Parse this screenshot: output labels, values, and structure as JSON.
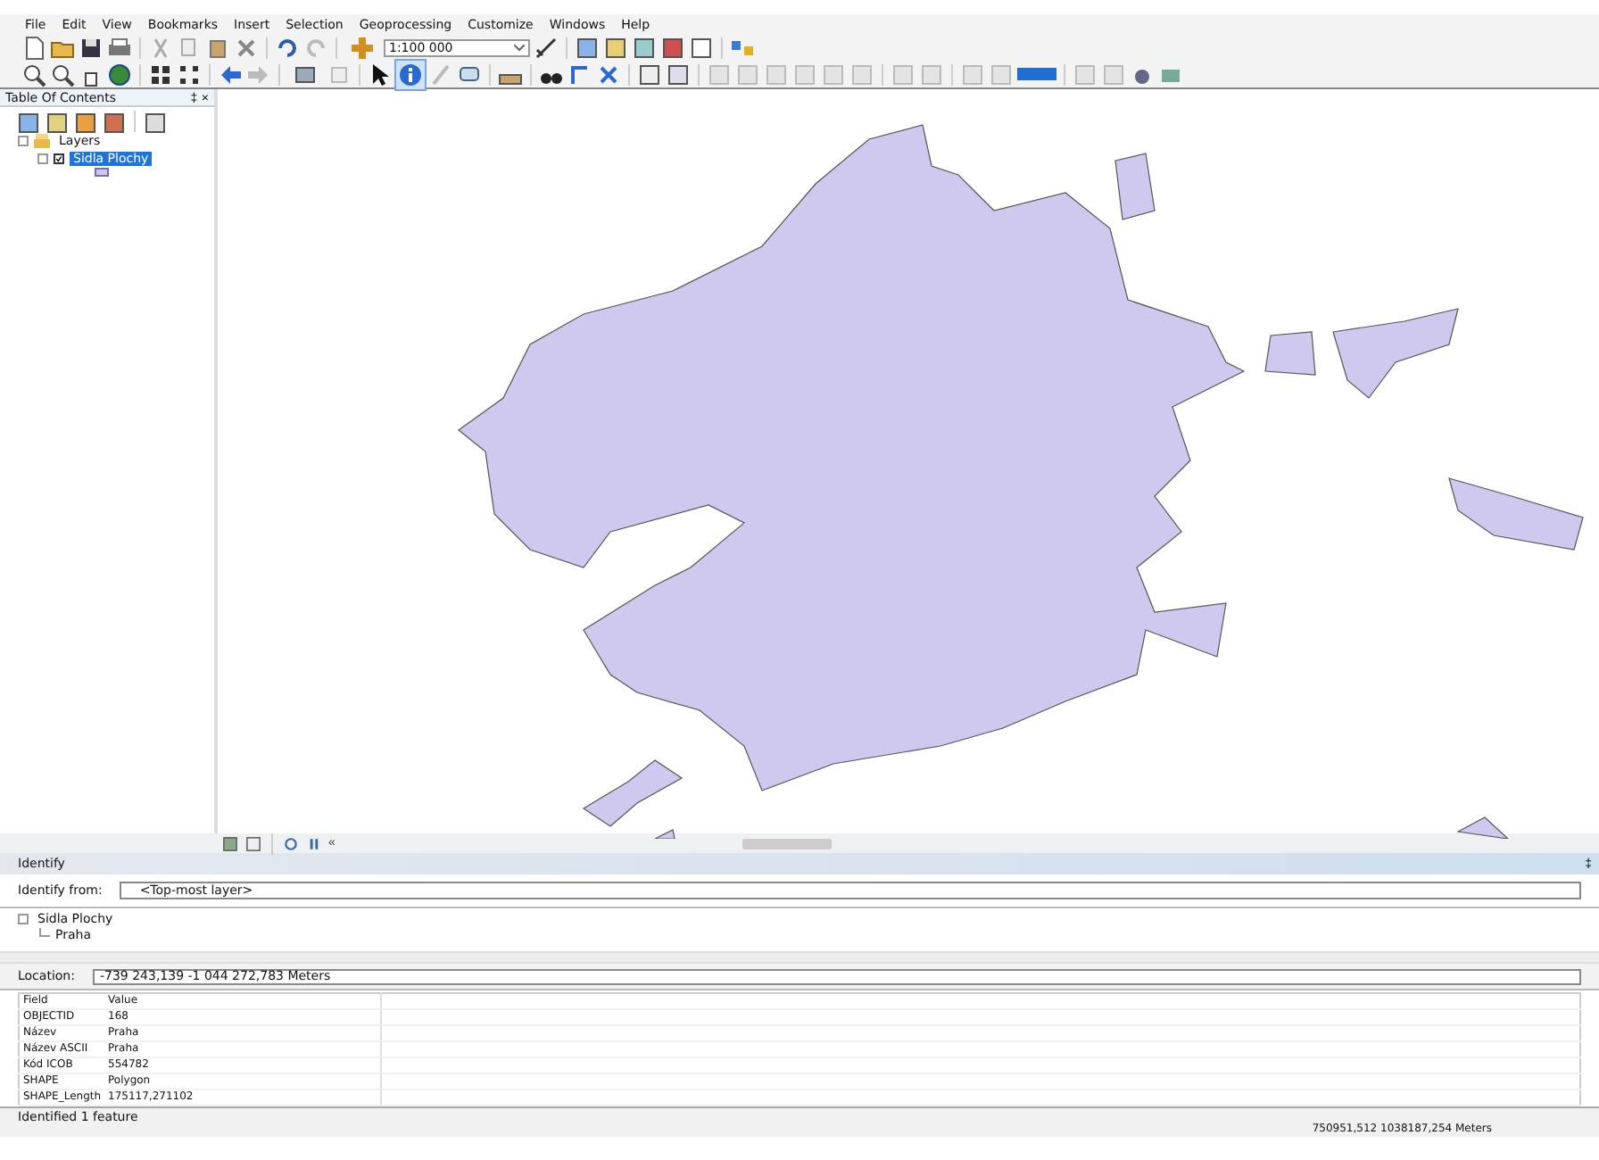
{
  "menu": [
    "File",
    "Edit",
    "View",
    "Bookmarks",
    "Insert",
    "Selection",
    "Geoprocessing",
    "Customize",
    "Windows",
    "Help"
  ],
  "toolbar": {
    "scale": "1:100 000"
  },
  "toc": {
    "title": "Table Of Contents",
    "pin": "‡",
    "close": "×",
    "root": {
      "label": "Layers",
      "expanded": true,
      "children": [
        {
          "label": "Sidla Plochy",
          "checked": true,
          "selected": true,
          "expanded": true
        }
      ]
    }
  },
  "map_bar": {
    "collapse": "«"
  },
  "identify": {
    "title": "Identify",
    "pin": "‡",
    "from_label": "Identify from:",
    "from_value": "<Top-most layer>",
    "tree": {
      "label": "Sidla Plochy",
      "expanded": true,
      "children": [
        {
          "label": "Praha"
        }
      ]
    },
    "location_label": "Location:",
    "location_value": "-739 243,139  -1 044 272,783 Meters",
    "columns": [
      "Field",
      "Value"
    ],
    "rows": [
      [
        "OBJECTID",
        "168"
      ],
      [
        "Název",
        "Praha"
      ],
      [
        "Název ASCII",
        "Praha"
      ],
      [
        "Kód ICOB",
        "554782"
      ],
      [
        "SHAPE",
        "Polygon"
      ],
      [
        "SHAPE_Length",
        "175117,271102"
      ]
    ]
  },
  "status_bar": {
    "message": "Identified 1 feature",
    "coordinates": "750951,512  1038187,254 Meters"
  }
}
